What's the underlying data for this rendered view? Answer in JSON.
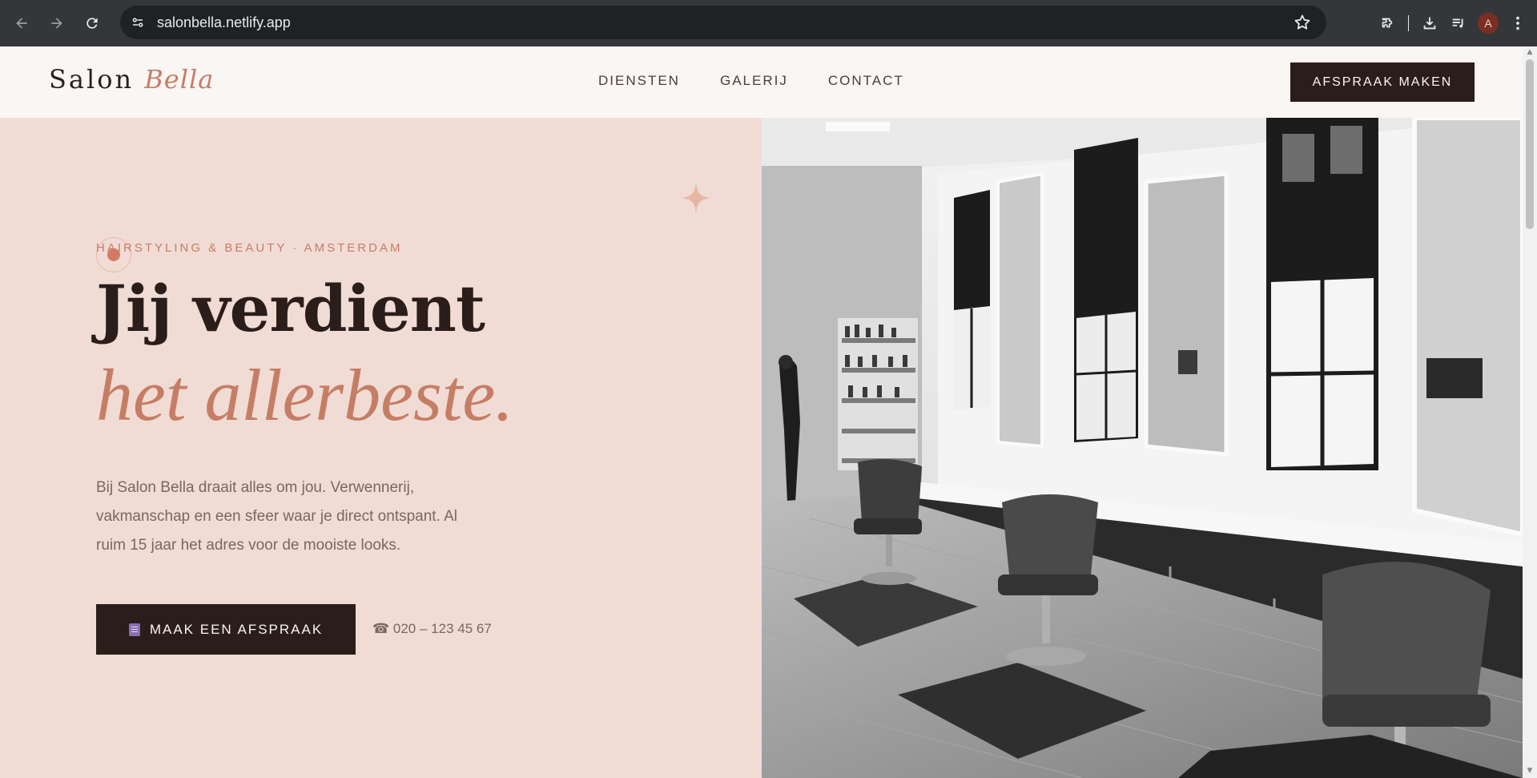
{
  "browser": {
    "url": "salonbella.netlify.app",
    "profile_initial": "A"
  },
  "header": {
    "logo_main": "Salon",
    "logo_accent": "Bella",
    "nav": [
      "DIENSTEN",
      "GALERIJ",
      "CONTACT"
    ],
    "cta_label": "AFSPRAAK MAKEN"
  },
  "hero": {
    "eyebrow": "HAIRSTYLING & BEAUTY · AMSTERDAM",
    "title_line1": "Jij verdient",
    "title_line2": "het allerbeste.",
    "lead": "Bij Salon Bella draait alles om jou. Verwennerij, vakmanschap en een sfeer waar je direct ontspant. Al ruim 15 jaar het adres voor de mooiste looks.",
    "cta_label": "MAAK EEN AFSPRAAK",
    "phone": "☎ 020 – 123 45 67"
  },
  "colors": {
    "accent": "#c67d66",
    "dark": "#2a1d1a",
    "hero_bg": "#f0dcd5",
    "header_bg": "#faf6f3"
  },
  "icons": [
    "back-icon",
    "forward-icon",
    "reload-icon",
    "site-info-icon",
    "bookmark-star-icon",
    "extensions-icon",
    "downloads-icon",
    "media-queue-icon",
    "menu-kebab-icon",
    "sparkle-icon",
    "calendar-icon"
  ]
}
